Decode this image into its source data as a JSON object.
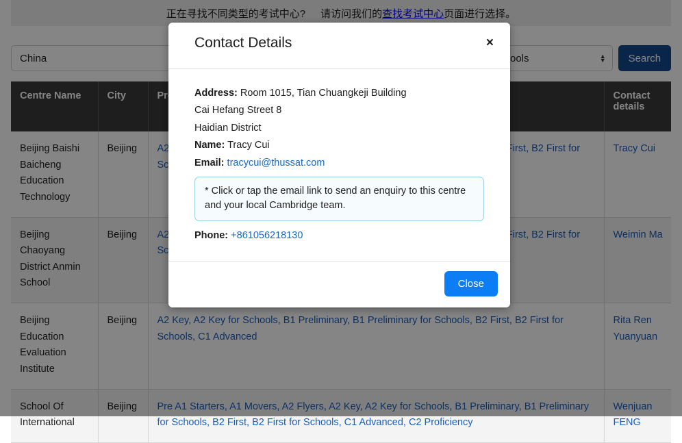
{
  "banner": {
    "text_before": "正在寻找不同类型的考试中心?",
    "text_middle": "请访问我们的",
    "link_text": "查找考试中心",
    "text_after": "页面进行选择。"
  },
  "search": {
    "country_value": "China",
    "middle_value": "",
    "type_value": "Schools",
    "search_label": "Search"
  },
  "table": {
    "headers": [
      "Centre Name",
      "City",
      "Products and services",
      "Contact details"
    ],
    "rows": [
      {
        "name": "Beijing Baishi Baicheng Education Technology",
        "city": "Beijing",
        "qualifications": "A2 Key, A2 Key for Schools, B1 Preliminary, B1 Preliminary for Schools CB, B2 First, B2 First for Schools",
        "contact": "Tracy Cui"
      },
      {
        "name": "Beijing Chaoyang District Anmin School",
        "city": "Beijing",
        "qualifications": "A2 Key, A2 Key for Schools, B1 Preliminary, B1 Preliminary for Schools CB, B2 First, B2 First for Schools, C1 Advanced CB",
        "contact": "Weimin Ma"
      },
      {
        "name": "Beijing Education Evaluation Institute",
        "city": "Beijing",
        "qualifications": "A2 Key, A2 Key for Schools, B1 Preliminary, B1 Preliminary for Schools, B2 First, B2 First for Schools, C1 Advanced",
        "contact": "Rita Ren Yuanyuan"
      },
      {
        "name": "School Of International",
        "city": "Beijing",
        "qualifications": "Pre A1 Starters, A1 Movers, A2 Flyers, A2 Key, A2 Key for Schools, B1 Preliminary, B1 Preliminary for Schools, B2 First, B2 First for Schools, C1 Advanced, C2 Proficiency",
        "contact": "Wenjuan FENG"
      }
    ]
  },
  "modal": {
    "title": "Contact Details",
    "close_icon": "×",
    "address_label": "Address:",
    "address_line1": "Room 1015, Tian Chuangkeji Building",
    "address_line2": "Cai Hefang Street 8",
    "address_line3": "Haidian District",
    "name_label": "Name:",
    "name_value": "Tracy Cui",
    "email_label": "Email:",
    "email_value": "tracycui@thussat.com",
    "note": "* Click or tap the email link to send an enquiry to this centre and your local Cambridge team.",
    "phone_label": "Phone:",
    "phone_value": "+861056218130",
    "close_button": "Close"
  },
  "colors": {
    "brand_blue": "#134a8e",
    "action_blue": "#0d7df5",
    "link_blue": "#1a5dbd",
    "header_dark": "#3a3a3a",
    "note_border": "#9fcbe3"
  }
}
